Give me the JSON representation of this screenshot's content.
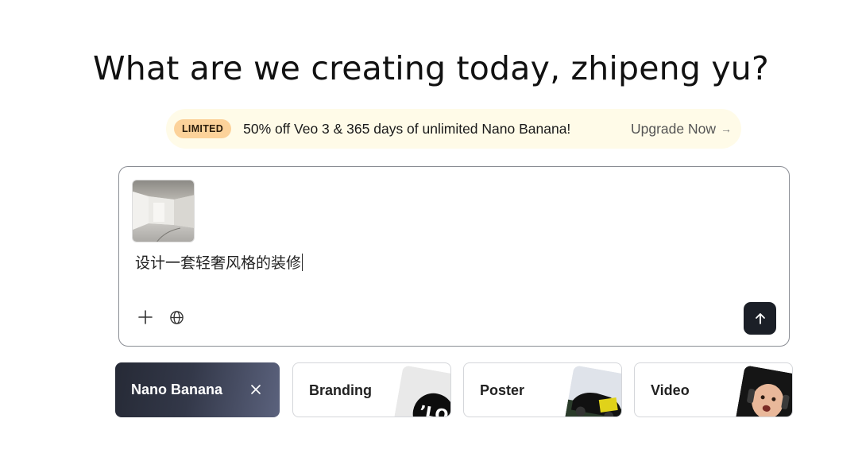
{
  "heading": "What are we creating today,  zhipeng yu?",
  "promo": {
    "badge": "LIMITED",
    "message": "50% off Veo 3 & 365 days of unlimited Nano Banana!",
    "cta": "Upgrade Now",
    "cta_icon": "arrow-right-icon"
  },
  "composer": {
    "attachment_icon": "image-thumbnail",
    "prompt_value": "设计一套轻奢风格的装修",
    "tools": [
      "plus-icon",
      "globe-icon"
    ],
    "send_icon": "arrow-up-icon"
  },
  "modes": [
    {
      "label": "Nano Banana",
      "active": true
    },
    {
      "label": "Branding",
      "active": false
    },
    {
      "label": "Poster",
      "active": false
    },
    {
      "label": "Video",
      "active": false
    }
  ],
  "colors": {
    "badge_bg": "#fcd29a",
    "promo_bg": "#fffbe8",
    "send_bg": "#1b1f27",
    "active_card_bg": "#333849"
  }
}
